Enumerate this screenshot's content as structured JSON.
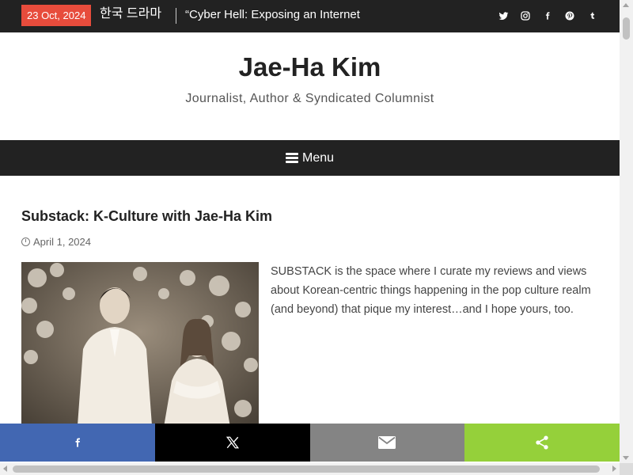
{
  "topbar": {
    "date": "23 Oct, 2024",
    "ticker_category": "한국 드라마",
    "ticker_text": "“Cyber Hell: Exposing an Internet",
    "social_icons": [
      "twitter-icon",
      "instagram-icon",
      "facebook-icon",
      "pinterest-icon",
      "tumblr-icon"
    ],
    "accent_color": "#e74c3c",
    "bar_color": "#222222"
  },
  "header": {
    "title": "Jae-Ha Kim",
    "tagline": "Journalist, Author & Syndicated Columnist"
  },
  "nav": {
    "menu_label": "Menu"
  },
  "post": {
    "title": "Substack: K-Culture with Jae-Ha Kim",
    "date": "April 1, 2024",
    "image_icon": "photo-couple",
    "excerpt": "SUBSTACK is the space where I curate my reviews and views about Korean-centric things happening in the pop culture realm (and beyond) that pique my interest…and I hope yours, too."
  },
  "share_bar": {
    "buttons": [
      {
        "icon": "facebook-icon",
        "color": "#4267b2"
      },
      {
        "icon": "x-icon",
        "color": "#000000"
      },
      {
        "icon": "email-icon",
        "color": "#848484"
      },
      {
        "icon": "share-icon",
        "color": "#95d03a"
      }
    ]
  }
}
